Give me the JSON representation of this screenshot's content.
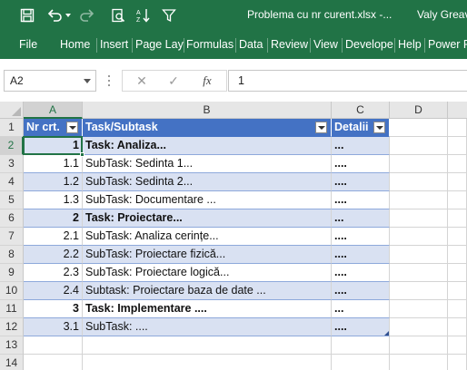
{
  "titlebar": {
    "file_title": "Problema cu nr curent.xlsx  -...",
    "user": "Valy Greav",
    "icons": [
      "save-icon",
      "undo-icon",
      "undo-dropdown-icon",
      "redo-icon",
      "print-preview-icon",
      "sort-icon",
      "filter-icon"
    ]
  },
  "ribbon": {
    "tabs": [
      "File",
      "Home",
      "Insert",
      "Page Lay",
      "Formulas",
      "Data",
      "Review",
      "View",
      "Develope",
      "Help",
      "Power P"
    ]
  },
  "formula_bar": {
    "name_box": "A2",
    "cancel_icon": "✕",
    "enter_icon": "✓",
    "function_icon": "fx",
    "value": "1"
  },
  "sheet": {
    "columns": [
      "A",
      "B",
      "C",
      "D"
    ],
    "rows": [
      "1",
      "2",
      "3",
      "4",
      "5",
      "6",
      "7",
      "8",
      "9",
      "10",
      "11",
      "12",
      "13",
      "14"
    ],
    "table_header": [
      "Nr crt.",
      "Task/Subtask",
      "Detalii"
    ],
    "table_rows": [
      {
        "nr": "1",
        "task": "Task: Analiza...",
        "detalii": "...",
        "bold": true
      },
      {
        "nr": "1.1",
        "task": "SubTask: Sedinta 1...",
        "detalii": "....",
        "bold": false
      },
      {
        "nr": "1.2",
        "task": "SubTask: Sedinta 2...",
        "detalii": "....",
        "bold": false
      },
      {
        "nr": "1.3",
        "task": "SubTask: Documentare ...",
        "detalii": "....",
        "bold": false
      },
      {
        "nr": "2",
        "task": "Task: Proiectare...",
        "detalii": "...",
        "bold": true
      },
      {
        "nr": "2.1",
        "task": "SubTask: Analiza cerințe...",
        "detalii": "....",
        "bold": false
      },
      {
        "nr": "2.2",
        "task": "SubTask: Proiectare fizică...",
        "detalii": "....",
        "bold": false
      },
      {
        "nr": "2.3",
        "task": "SubTask: Proiectare logică...",
        "detalii": "....",
        "bold": false
      },
      {
        "nr": "2.4",
        "task": "Subtask: Proiectare baza de date ...",
        "detalii": "....",
        "bold": false
      },
      {
        "nr": "3",
        "task": "Task: Implementare ....",
        "detalii": "...",
        "bold": true
      },
      {
        "nr": "3.1",
        "task": "SubTask: ....",
        "detalii": "....",
        "bold": false
      }
    ],
    "selected_cell": "A2",
    "colors": {
      "ribbon": "#217346",
      "table_header": "#4472c4",
      "band": "#d9e1f2",
      "selection": "#217346"
    }
  }
}
